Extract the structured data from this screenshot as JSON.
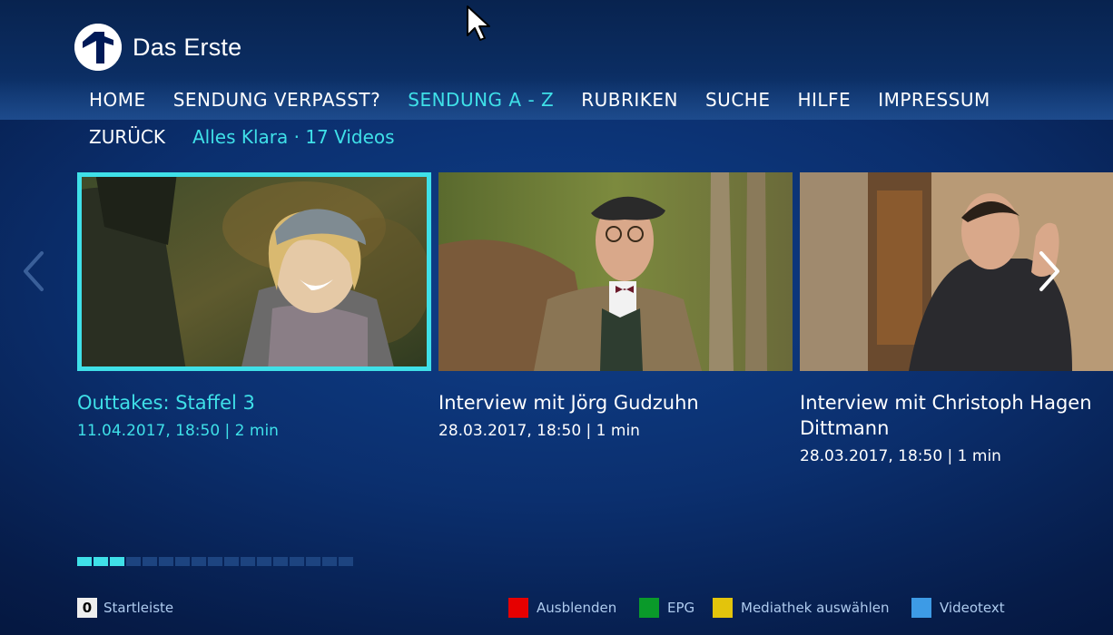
{
  "brand": {
    "name": "Das Erste",
    "logo_mark": "1"
  },
  "nav": {
    "items": [
      {
        "label": "HOME",
        "active": false
      },
      {
        "label": "SENDUNG VERPASST?",
        "active": false
      },
      {
        "label": "SENDUNG A - Z",
        "active": true
      },
      {
        "label": "RUBRIKEN",
        "active": false
      },
      {
        "label": "SUCHE",
        "active": false
      },
      {
        "label": "HILFE",
        "active": false
      },
      {
        "label": "IMPRESSUM",
        "active": false
      }
    ]
  },
  "subnav": {
    "back_label": "ZURÜCK",
    "breadcrumb": "Alles Klara · 17 Videos"
  },
  "cards": [
    {
      "title": "Outtakes: Staffel 3",
      "meta": "11.04.2017, 18:50 | 2 min",
      "selected": true
    },
    {
      "title": "Interview mit Jörg Gudzuhn",
      "meta": "28.03.2017, 18:50 | 1 min",
      "selected": false
    },
    {
      "title": "Interview mit Christoph Hagen",
      "title_line2": "Dittmann",
      "meta": "28.03.2017, 18:50 | 1 min",
      "selected": false
    }
  ],
  "pager": {
    "total": 17,
    "active": [
      0,
      1,
      2
    ]
  },
  "footer": {
    "startleiste": {
      "key": "0",
      "label": "Startleiste"
    },
    "buttons": [
      {
        "label": "Ausblenden",
        "color": "#e60000"
      },
      {
        "label": "EPG",
        "color": "#0a9a2a"
      },
      {
        "label": "Mediathek auswählen",
        "color": "#e3c40c"
      },
      {
        "label": "Videotext",
        "color": "#3d9be6"
      }
    ]
  },
  "colors": {
    "accent": "#3fe0e8",
    "background": "#0b2f6e"
  },
  "icons": {
    "left": "chevron-left-icon",
    "right": "chevron-right-icon",
    "cursor": "mouse-pointer-icon"
  }
}
